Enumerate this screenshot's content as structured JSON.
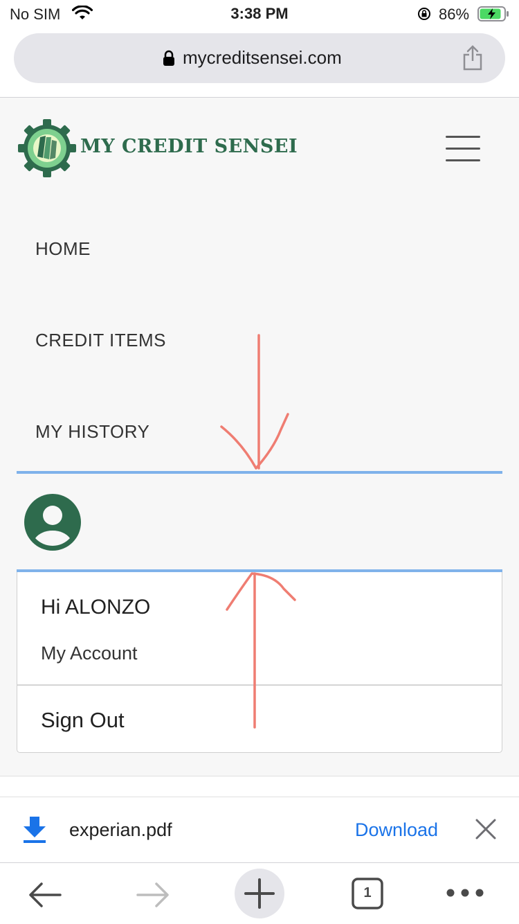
{
  "status_bar": {
    "carrier": "No SIM",
    "time": "3:38 PM",
    "battery_percent": "86%"
  },
  "browser": {
    "url": "mycreditsensei.com"
  },
  "site": {
    "brand": "MY CREDIT SENSEI",
    "nav": [
      "HOME",
      "CREDIT ITEMS",
      "MY HISTORY"
    ],
    "colors": {
      "brand_green": "#2e6b4d",
      "logo_light_green": "#7ed08f",
      "highlight_blue": "#7fb2ea"
    }
  },
  "account_menu": {
    "greeting": "Hi ALONZO",
    "my_account": "My Account",
    "sign_out": "Sign Out"
  },
  "download_bar": {
    "filename": "experian.pdf",
    "action": "Download"
  },
  "toolbar": {
    "tab_count": "1"
  },
  "annotation_color": "#ef7d72"
}
